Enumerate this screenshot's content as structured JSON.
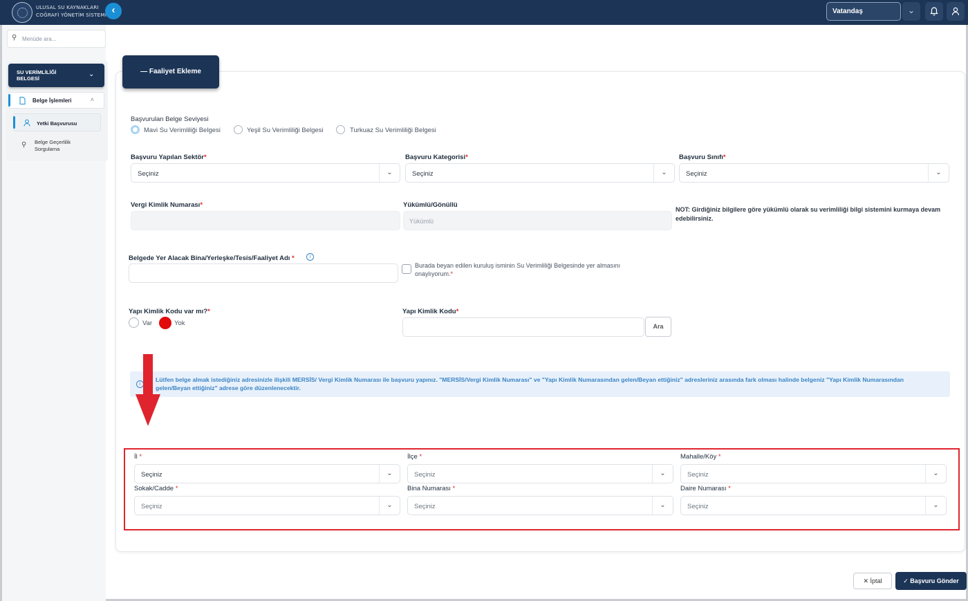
{
  "header": {
    "brand_line1": "ULUSAL SU KAYNAKLARI",
    "brand_line2": "COĞRAFİ YÖNETİM SİSTEMİ",
    "role": "Vatandaş"
  },
  "sidebar": {
    "search_placeholder": "Menüde ara...",
    "module_line1": "SU VERİMLİLİĞİ",
    "module_line2": "BELGESİ",
    "group_label": "Belge İşlemleri",
    "items": [
      {
        "label": "Yetki Başvurusu"
      },
      {
        "label_line1": "Belge Geçerlilik",
        "label_line2": "Sorgulama"
      }
    ]
  },
  "form": {
    "activity_button": "Faaliyet Ekleme",
    "level_label": "Başvurulan Belge Seviyesi",
    "level_options": [
      "Mavi Su Verimliliği Belgesi",
      "Yeşil Su Verimliliği Belgesi",
      "Turkuaz Su Verimliliği Belgesi"
    ],
    "sector_label": "Başvuru Yapılan Sektör",
    "category_label": "Başvuru Kategorisi",
    "class_label": "Başvuru Sınıfı",
    "select_placeholder": "Seçiniz",
    "tax_label": "Vergi Kimlik Numarası",
    "obligation_label": "Yükümlü/Gönüllü",
    "obligation_value": "Yükümlü",
    "note": "NOT: Girdiğiniz bilgilere göre yükümlü olarak su verimliliği bilgi sistemini kurmaya devam edebilirsiniz.",
    "facility_label": "Belgede Yer Alacak Bina/Yerleşke/Tesis/Faaliyet Adı",
    "consent_text": "Burada beyan edilen kuruluş isminin Su Verimliliği Belgesinde yer almasını onaylıyorum.",
    "building_id_question": "Yapı Kimlik Kodu var mı?",
    "building_id_options": [
      "Var",
      "Yok"
    ],
    "building_id_label": "Yapı Kimlik Kodu",
    "search_button": "Ara",
    "info_text": "Lütfen belge almak istediğiniz adresinizle ilişkili MERSİS/ Vergi Kimlik Numarası ile başvuru yapınız. \"MERSİS/Vergi Kimlik Numarası\" ve \"Yapı Kimlik Numarasından gelen/Beyan ettiğiniz\" adresleriniz arasında fark olması halinde belgeniz \"Yapı Kimlik Numarasından gelen/Beyan ettiğiniz\" adrese göre düzenlenecektir.",
    "address": {
      "il": "İl",
      "ilce": "İlçe",
      "mahalle": "Mahalle/Köy",
      "sokak": "Sokak/Cadde",
      "bina": "Bina Numarası",
      "daire": "Daire Numarası"
    }
  },
  "footer": {
    "cancel": "İptal",
    "submit": "Başvuru Gönder"
  },
  "colors": {
    "navy": "#1c3557",
    "accent": "#1a8fd6",
    "highlight": "#e0242d",
    "info_bg": "#e8f1fb"
  }
}
